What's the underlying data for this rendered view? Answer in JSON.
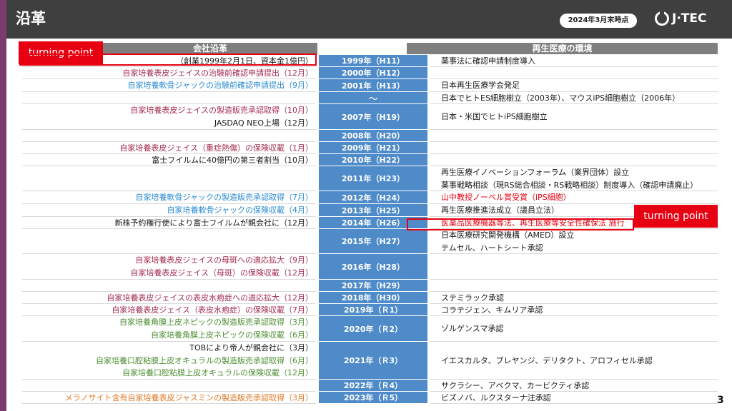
{
  "header": {
    "title": "沿革",
    "date_badge": "2024年3月末時点",
    "logo": "J·TEC"
  },
  "columns": {
    "left": "会社沿革",
    "right": "再生医療の環境"
  },
  "callouts": {
    "left": "turning point",
    "right": "turning point"
  },
  "page_number": "3",
  "colors": {
    "header_bg": "#3f3f3f",
    "accent": "#7a3b6e",
    "year_bg": "#4f8bc9",
    "highlight": "#e60012"
  },
  "rows": [
    {
      "year": "1999年（H11）",
      "left": [
        {
          "text": "（創業1999年2月1日、資本金1億円）",
          "color": "dark"
        }
      ],
      "right": [
        {
          "text": "薬事法に確認申請制度導入",
          "color": "dark"
        }
      ]
    },
    {
      "year": "2000年（H12）",
      "left": [
        {
          "text": "自家培養表皮ジェイスの治験前確認申請提出（12月）",
          "color": "maroon"
        }
      ],
      "right": []
    },
    {
      "year": "2001年（H13）",
      "left": [
        {
          "text": "自家培養軟骨ジャックの治験前確認申請提出（9月）",
          "color": "blue"
        }
      ],
      "right": [
        {
          "text": "日本再生医療学会発足",
          "color": "dark"
        }
      ]
    },
    {
      "year": "～",
      "left": [],
      "right": [
        {
          "text": "日本でヒトES細胞樹立（2003年）、マウスiPS細胞樹立（2006年）",
          "color": "dark"
        }
      ]
    },
    {
      "year": "2007年（H19）",
      "left": [
        {
          "text": "自家培養表皮ジェイスの製造販売承認取得（10月）",
          "color": "maroon"
        },
        {
          "text": "JASDAQ NEO上場（12月）",
          "color": "dark"
        }
      ],
      "right": [
        {
          "text": "日本・米国でヒトiPS細胞樹立",
          "color": "dark"
        }
      ]
    },
    {
      "year": "2008年（H20）",
      "left": [],
      "right": []
    },
    {
      "year": "2009年（H21）",
      "left": [
        {
          "text": "自家培養表皮ジェイス（重症熱傷）の保険収載（1月）",
          "color": "maroon"
        }
      ],
      "right": []
    },
    {
      "year": "2010年（H22）",
      "left": [
        {
          "text": "富士フイルムに40億円の第三者割当（10月）",
          "color": "dark"
        }
      ],
      "right": []
    },
    {
      "year": "2011年（H23）",
      "left": [],
      "right": [
        {
          "text": "再生医療イノベーションフォーラム（業界団体）設立",
          "color": "dark"
        },
        {
          "text": "薬事戦略相談（現RS総合相談・RS戦略相談）制度導入（確認申請廃止）",
          "color": "dark"
        }
      ]
    },
    {
      "year": "2012年（H24）",
      "left": [
        {
          "text": "自家培養軟骨ジャックの製造販売承認取得（7月）",
          "color": "blue"
        }
      ],
      "right": [
        {
          "text": "山中教授ノーベル賞受賞（iPS細胞）",
          "color": "red"
        }
      ]
    },
    {
      "year": "2013年（H25）",
      "left": [
        {
          "text": "自家培養軟骨ジャックの保険収載（4月）",
          "color": "blue"
        }
      ],
      "right": [
        {
          "text": "再生医療推進法成立（議員立法）",
          "color": "dark"
        }
      ]
    },
    {
      "year": "2014年（H26）",
      "left": [
        {
          "text": "新株予約権行使により富士フイルムが親会社に（12月）",
          "color": "dark"
        }
      ],
      "right": [
        {
          "text": "医薬品医療機器等法、再生医療等安全性確保法 施行",
          "color": "red"
        }
      ]
    },
    {
      "year": "2015年（H27）",
      "left": [],
      "right": [
        {
          "text": "日本医療研究開発機構（AMED）設立",
          "color": "dark"
        },
        {
          "text": "テムセル、ハートシート承認",
          "color": "dark"
        }
      ]
    },
    {
      "year": "2016年（H28）",
      "left": [
        {
          "text": "自家培養表皮ジェイスの母斑への適応拡大（9月）",
          "color": "maroon"
        },
        {
          "text": "自家培養表皮ジェイス（母斑）の保険収載（12月）",
          "color": "maroon"
        }
      ],
      "right": []
    },
    {
      "year": "2017年（H29）",
      "left": [],
      "right": []
    },
    {
      "year": "2018年（H30）",
      "left": [
        {
          "text": "自家培養表皮ジェイスの表皮水疱症への適応拡大（12月）",
          "color": "maroon"
        }
      ],
      "right": [
        {
          "text": "ステミラック承認",
          "color": "dark"
        }
      ]
    },
    {
      "year": "2019年（Ｒ1）",
      "left": [
        {
          "text": "自家培養表皮ジェイス（表皮水疱症）の保険収載（7月）",
          "color": "maroon"
        }
      ],
      "right": [
        {
          "text": "コラテジェン、キムリア承認",
          "color": "dark"
        }
      ]
    },
    {
      "year": "2020年（Ｒ2）",
      "left": [
        {
          "text": "自家培養角膜上皮ネピックの製造販売承認取得（3月）",
          "color": "green"
        },
        {
          "text": "自家培養角膜上皮ネピックの保険収載（6月）",
          "color": "green"
        }
      ],
      "right": [
        {
          "text": "ゾルゲンスマ承認",
          "color": "dark"
        }
      ]
    },
    {
      "year": "2021年（Ｒ3）",
      "left": [
        {
          "text": "TOBにより帝人が親会社に（3月）",
          "color": "dark"
        },
        {
          "text": "自家培養口腔粘膜上皮オキュラルの製造販売承認取得（6月）",
          "color": "green"
        },
        {
          "text": "自家培養口腔粘膜上皮オキュラルの保険収載（12月）",
          "color": "green"
        }
      ],
      "right": [
        {
          "text": "イエスカルタ、ブレヤンジ、デリタクト、アロフィセル承認",
          "color": "dark"
        }
      ]
    },
    {
      "year": "2022年（Ｒ4）",
      "left": [],
      "right": [
        {
          "text": "サクラシー、アベクマ、カービクティ承認",
          "color": "dark"
        }
      ]
    },
    {
      "year": "2023年（Ｒ5）",
      "left": [
        {
          "text": "メラノサイト含有自家培養表皮ジャスミンの製造販売承認取得（3月）",
          "color": "orange"
        }
      ],
      "right": [
        {
          "text": "ビズノバ、ルクスターナ注承認",
          "color": "dark"
        }
      ]
    }
  ]
}
